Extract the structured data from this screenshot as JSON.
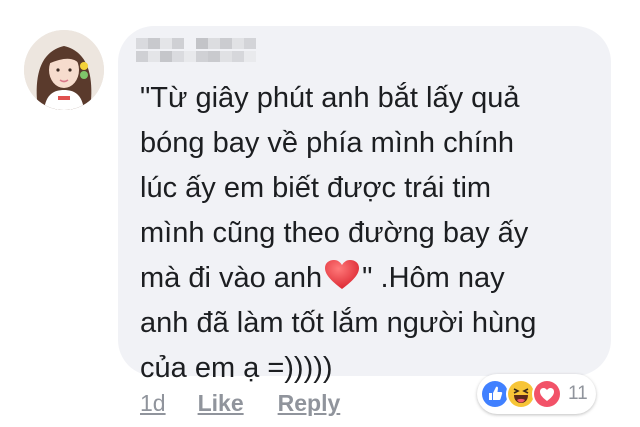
{
  "comment": {
    "author_name": "",
    "text_part1": "\"Từ giây phút anh bắt lấy quả\nbóng bay về phía mình chính\nlúc ấy em biết được trái tim\nmình cũng theo đường bay ấy\nmà đi vào anh",
    "text_part2": "\" .Hôm nay\nanh đã làm tốt lắm người hùng\ncủa em ạ =)))))",
    "inline_emoji": "heart-icon"
  },
  "footer": {
    "time": "1d",
    "like_label": "Like",
    "reply_label": "Reply"
  },
  "reactions": {
    "icons": [
      "like-reaction-icon",
      "haha-reaction-icon",
      "love-reaction-icon"
    ],
    "count": "11"
  },
  "colors": {
    "bubble": "#f1f2f6",
    "text": "#1c1e21",
    "meta": "#90949c",
    "like_blue": "#4080ff",
    "haha_yellow": "#f7c537",
    "love_red": "#f25268"
  }
}
